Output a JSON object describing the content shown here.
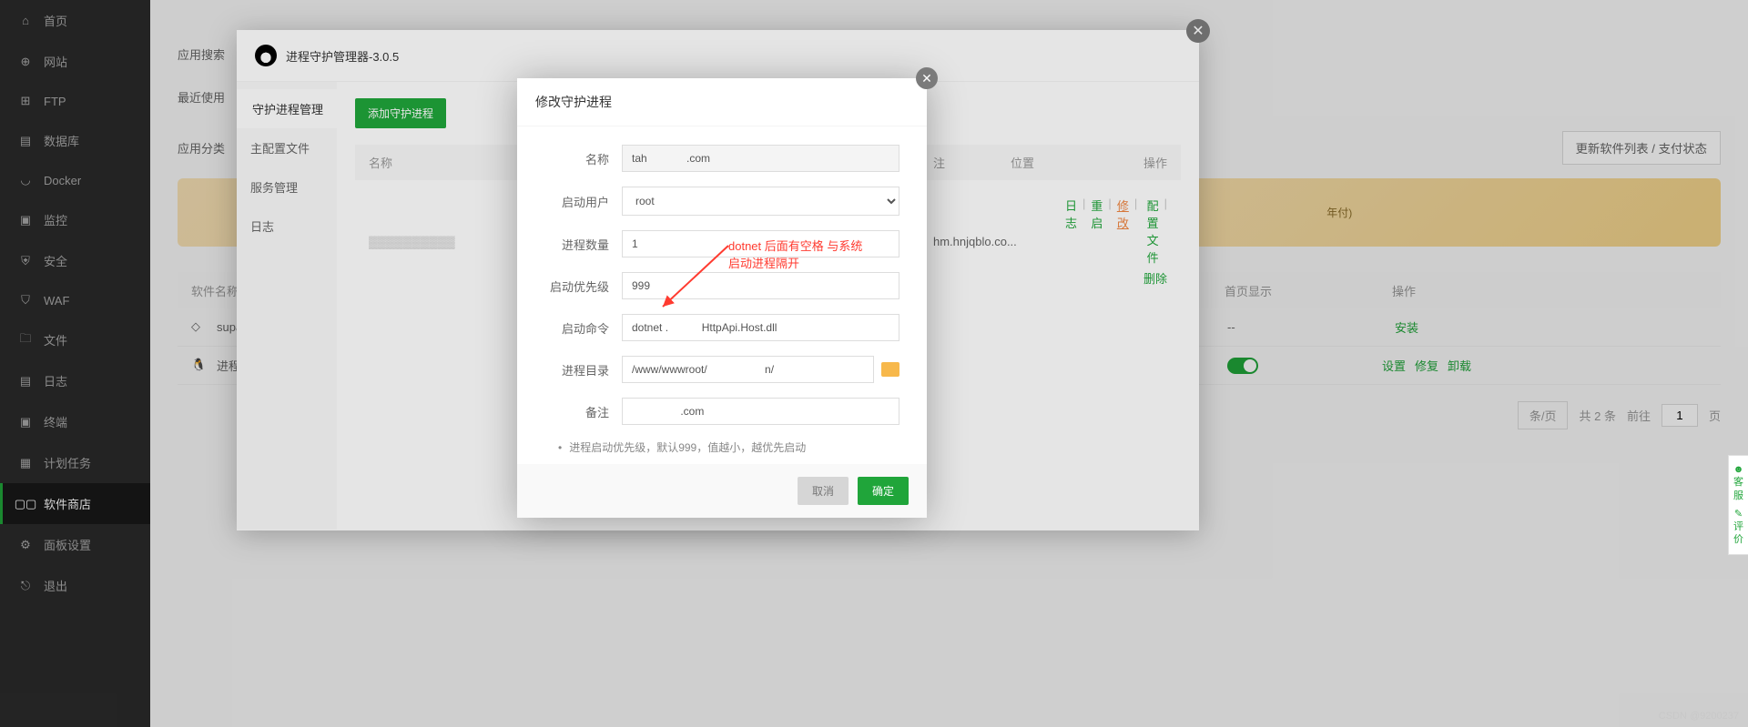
{
  "sidebar": {
    "items": [
      {
        "label": "首页",
        "icon": "home"
      },
      {
        "label": "网站",
        "icon": "globe"
      },
      {
        "label": "FTP",
        "icon": "ftp"
      },
      {
        "label": "数据库",
        "icon": "db"
      },
      {
        "label": "Docker",
        "icon": "docker"
      },
      {
        "label": "监控",
        "icon": "monitor"
      },
      {
        "label": "安全",
        "icon": "shield"
      },
      {
        "label": "WAF",
        "icon": "waf"
      },
      {
        "label": "文件",
        "icon": "folder"
      },
      {
        "label": "日志",
        "icon": "log"
      },
      {
        "label": "终端",
        "icon": "terminal"
      },
      {
        "label": "计划任务",
        "icon": "task"
      },
      {
        "label": "软件商店",
        "icon": "store"
      },
      {
        "label": "面板设置",
        "icon": "settings"
      },
      {
        "label": "退出",
        "icon": "exit"
      }
    ],
    "active_index": 12
  },
  "top": {
    "search_label": "应用搜索",
    "recent_label": "最近使用",
    "cat_label": "应用分类",
    "update_btn": "更新软件列表 / 支付状态"
  },
  "banner_text": "年付)",
  "table": {
    "head": {
      "name": "软件名称",
      "show": "首页显示",
      "op": "操作"
    },
    "rows": [
      {
        "icon": "cube",
        "name": "supa",
        "show": "--",
        "ops": [
          "安装"
        ]
      },
      {
        "icon": "tux",
        "name": "进程",
        "toggle": true,
        "ops": [
          "设置",
          "修复",
          "卸载"
        ]
      }
    ]
  },
  "pagination": {
    "per_page": "条/页",
    "total_prefix": "共",
    "total_num": "2",
    "total_suffix": "条",
    "goto": "前往",
    "page": "1",
    "page_suffix": "页"
  },
  "modal1": {
    "title": "进程守护管理器-3.0.5",
    "nav": [
      "守护进程管理",
      "主配置文件",
      "服务管理",
      "日志"
    ],
    "nav_active": 0,
    "add_btn": "添加守护进程",
    "thead": {
      "name": "名称",
      "note": "注",
      "pos": "位置",
      "op": "操作"
    },
    "row": {
      "name": "",
      "note": "hm.hnjqblo.co...",
      "actions": [
        "日志",
        "重启",
        "修改",
        "配置文件",
        "删除"
      ]
    }
  },
  "modal2": {
    "title": "修改守护进程",
    "fields": {
      "name": {
        "label": "名称",
        "value": "tah             .com"
      },
      "user": {
        "label": "启动用户",
        "value": "root"
      },
      "count": {
        "label": "进程数量",
        "value": "1"
      },
      "priority": {
        "label": "启动优先级",
        "value": "999"
      },
      "cmd": {
        "label": "启动命令",
        "value": "dotnet .           HttpApi.Host.dll"
      },
      "dir": {
        "label": "进程目录",
        "value": "/www/wwwroot/                   n/"
      },
      "note": {
        "label": "备注",
        "value": "                .com"
      }
    },
    "hint": "进程启动优先级，默认999，值越小，越优先启动",
    "cancel": "取消",
    "ok": "确定"
  },
  "annotation": {
    "line1": "dotnet 后面有空格 与系统",
    "line2": "启动进程隔开"
  },
  "side_tab": {
    "t1": "客服",
    "t2": "评价"
  },
  "watermark": "CSDN @9200237"
}
